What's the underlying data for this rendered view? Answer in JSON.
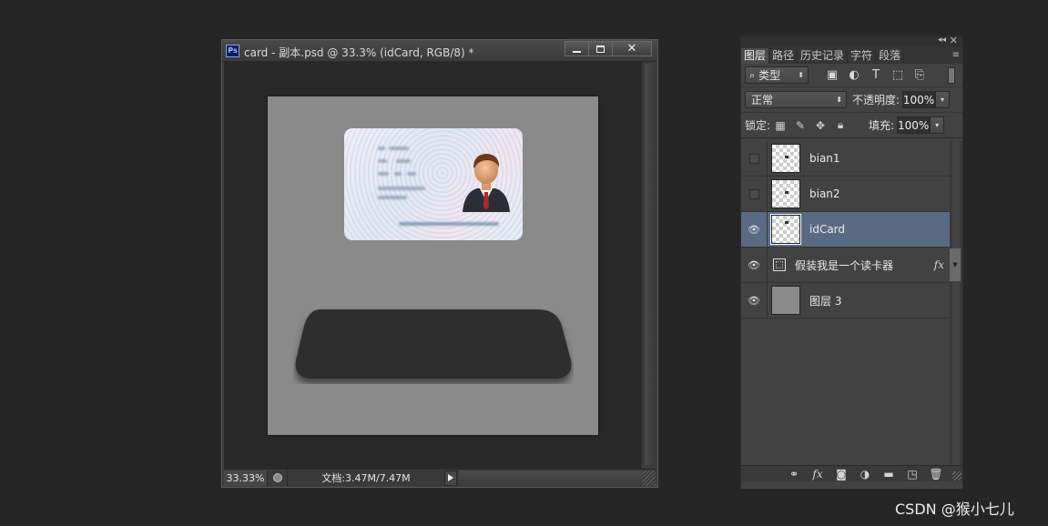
{
  "document": {
    "title": "card - 副本.psd @ 33.3% (idCard, RGB/8) *",
    "ps_logo": "Ps",
    "window_controls": {
      "minimize": "",
      "maximize": "",
      "close": "✕"
    },
    "status": {
      "zoom": "33.33%",
      "doc_size": "文档:3.47M/7.47M"
    }
  },
  "panel": {
    "header": {
      "collapse": "◂◂",
      "close": "✕"
    },
    "tabs": [
      "图层",
      "路径",
      "历史记录",
      "字符",
      "段落"
    ],
    "active_tab": 0,
    "menu_icon": "≡",
    "filter": {
      "icon": "⌕",
      "label": "类型",
      "arrow": "⬍"
    },
    "filter_icons": [
      "image-filter-icon",
      "adjustment-filter-icon",
      "type-filter-icon",
      "shape-filter-icon",
      "smart-object-filter-icon"
    ],
    "blend_mode": "正常",
    "blend_arrow": "⬍",
    "opacity_label": "不透明度:",
    "opacity": "100%",
    "lock_label": "锁定:",
    "fill_label": "填充:",
    "fill": "100%",
    "dropdown_arrow": "▾",
    "layers": [
      {
        "name": "bian1",
        "visible": false,
        "thumb": "transparent"
      },
      {
        "name": "bian2",
        "visible": false,
        "thumb": "transparent"
      },
      {
        "name": "idCard",
        "visible": true,
        "thumb": "transparent",
        "selected": true
      },
      {
        "name": "假装我是一个读卡器",
        "visible": true,
        "thumb": "shape",
        "fx": "fx"
      },
      {
        "name": "图层 3",
        "visible": true,
        "thumb": "solid"
      }
    ],
    "bottom_icons": [
      "link-layers-icon",
      "fx-icon",
      "mask-icon",
      "adjustment-layer-icon",
      "group-folder-icon",
      "new-layer-icon",
      "trash-icon"
    ]
  },
  "watermark": "CSDN @猴小七儿",
  "colors": {
    "selected_layer": "#5b6a83",
    "artboard": "#8a8a8a",
    "reader": "#2e2e2e"
  }
}
